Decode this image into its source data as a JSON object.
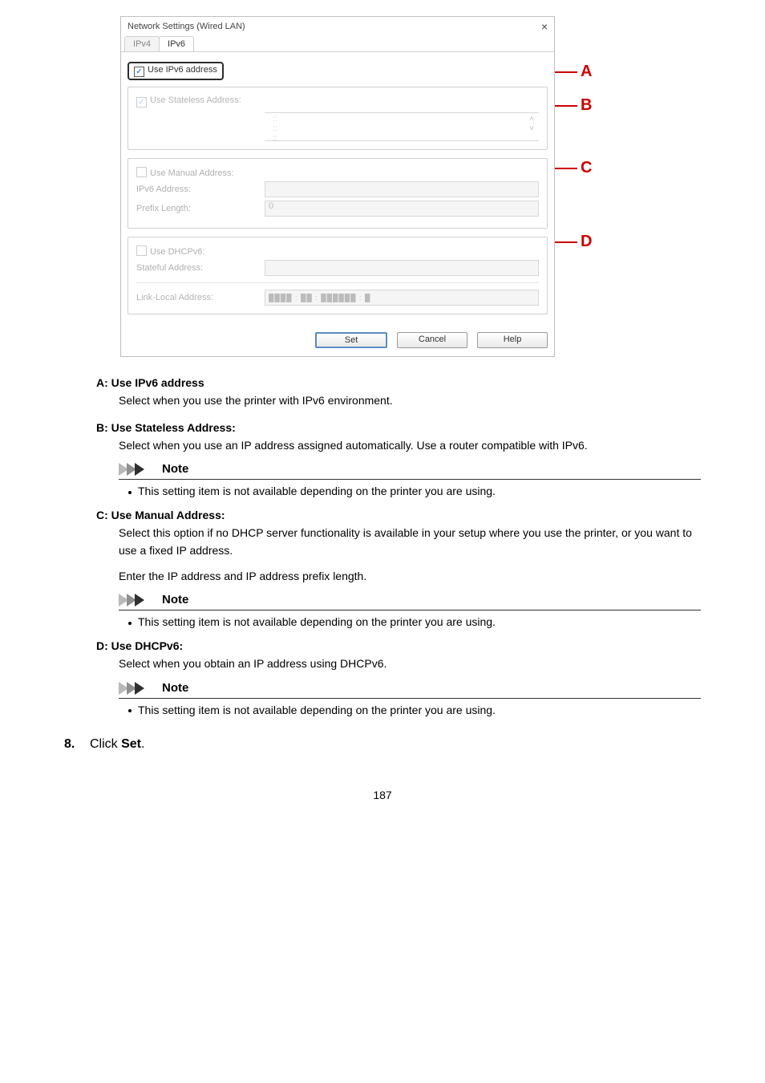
{
  "callouts": {
    "a": "A",
    "b": "B",
    "c": "C",
    "d": "D"
  },
  "dlg": {
    "title": "Network Settings (Wired LAN)",
    "close_glyph": "×",
    "tabs": {
      "ipv4": "IPv4",
      "ipv6": "IPv6"
    },
    "useIpv6": {
      "label": "Use IPv6 address",
      "checked": "✓"
    },
    "stateless": {
      "label": "Use Stateless Address:",
      "checked": "✓",
      "list_placeholder": "::\n::\n::",
      "spin_up": "˄",
      "spin_down": "˅"
    },
    "manual": {
      "label": "Use Manual Address:",
      "addr_label": "IPv6 Address:",
      "prefix_label": "Prefix Length:",
      "prefix_value": "0"
    },
    "dhcpv6": {
      "label": "Use DHCPv6:",
      "stateful_label": "Stateful Address:"
    },
    "linkLocal": {
      "label": "Link-Local Address:",
      "value_redacted": "████ : ██ : ██████ : █"
    },
    "buttons": {
      "set": "Set",
      "cancel": "Cancel",
      "help": "Help"
    }
  },
  "sections": {
    "a": {
      "title": "A: Use IPv6 address",
      "text": "Select when you use the printer with IPv6 environment."
    },
    "b": {
      "title": "B: Use Stateless Address:",
      "text": "Select when you use an IP address assigned automatically. Use a router compatible with IPv6.",
      "note": "This setting item is not available depending on the printer you are using."
    },
    "c": {
      "title": "C: Use Manual Address:",
      "text1": "Select this option if no DHCP server functionality is available in your setup where you use the printer, or you want to use a fixed IP address.",
      "text2": "Enter the IP address and IP address prefix length.",
      "note": "This setting item is not available depending on the printer you are using."
    },
    "d": {
      "title": "D: Use DHCPv6:",
      "text": "Select when you obtain an IP address using DHCPv6.",
      "note": "This setting item is not available depending on the printer you are using."
    }
  },
  "noteLabel": "Note",
  "step": {
    "num": "8.",
    "pre": "Click ",
    "bold": "Set",
    "post": "."
  },
  "pageNumber": "187"
}
